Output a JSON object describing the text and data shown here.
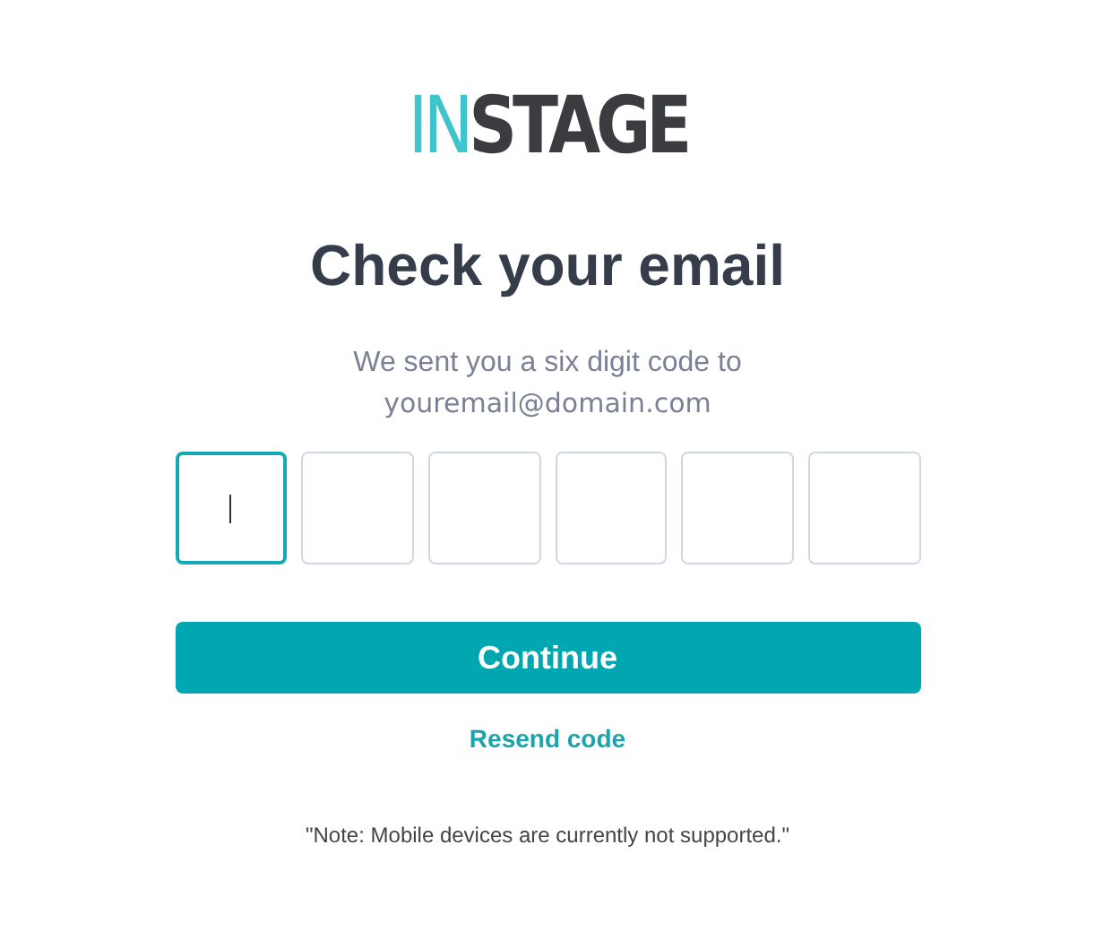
{
  "logo": {
    "accent": "IN",
    "main": "STAGE"
  },
  "title": "Check your email",
  "message": {
    "line": "We sent you a six digit code to",
    "email": "youremail@domain.com"
  },
  "code_fields": [
    {
      "selected": true
    },
    {
      "selected": false
    },
    {
      "selected": false
    },
    {
      "selected": false
    },
    {
      "selected": false
    },
    {
      "selected": false
    }
  ],
  "continue_button": "Continue",
  "resend_link": "Resend code",
  "note": "\"Note: Mobile devices are currently not supported.\""
}
